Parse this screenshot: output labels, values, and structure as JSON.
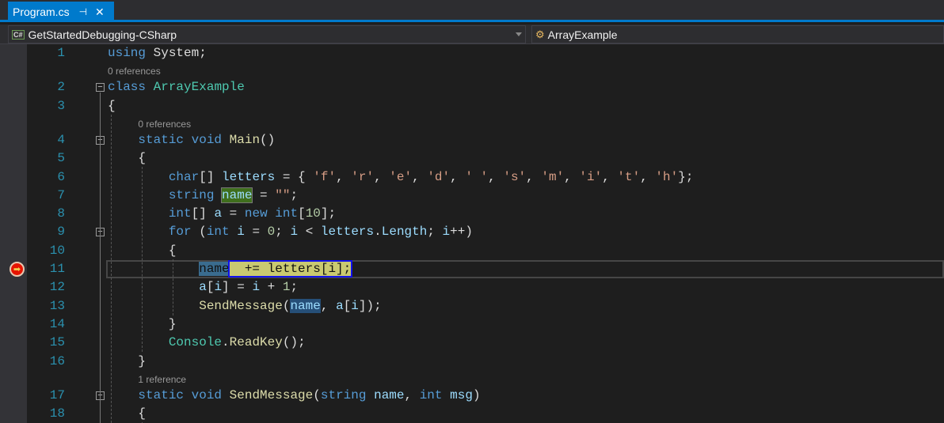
{
  "tab": {
    "title": "Program.cs",
    "pin": "⊣",
    "close": "✕"
  },
  "nav": {
    "project": "GetStartedDebugging-CSharp",
    "project_icon": "C#",
    "class": "ArrayExample"
  },
  "colors": {
    "accent": "#007acc",
    "line_number": "#2b91af",
    "keyword": "#569cd6",
    "type": "#4ec9b0",
    "method": "#dcdcaa",
    "variable": "#9cdcfe",
    "string": "#d69d85"
  },
  "lines": [
    {
      "no": "1",
      "tokens": [
        [
          "using",
          "k"
        ],
        " ",
        [
          "System",
          "c"
        ],
        ";"
      ]
    },
    {
      "ref": "0 references",
      "indent": 0
    },
    {
      "no": "2",
      "fold": true,
      "tokens": [
        [
          "class",
          "k"
        ],
        " ",
        [
          "ArrayExample",
          "t"
        ]
      ]
    },
    {
      "no": "3",
      "tokens": [
        "{"
      ]
    },
    {
      "ref": "0 references",
      "indent": 1
    },
    {
      "no": "4",
      "fold": true,
      "tokens": [
        "    ",
        [
          "static",
          "k"
        ],
        " ",
        [
          "void",
          "k"
        ],
        " ",
        [
          "Main",
          "m"
        ],
        "()"
      ]
    },
    {
      "no": "5",
      "tokens": [
        "    {"
      ]
    },
    {
      "no": "6",
      "tokens": [
        "        ",
        [
          "char",
          "k"
        ],
        "[] ",
        [
          "letters",
          "v"
        ],
        " = { ",
        [
          "'f'",
          "s"
        ],
        ", ",
        [
          "'r'",
          "s"
        ],
        ", ",
        [
          "'e'",
          "s"
        ],
        ", ",
        [
          "'d'",
          "s"
        ],
        ", ",
        [
          "' '",
          "s"
        ],
        ", ",
        [
          "'s'",
          "s"
        ],
        ", ",
        [
          "'m'",
          "s"
        ],
        ", ",
        [
          "'i'",
          "s"
        ],
        ", ",
        [
          "'t'",
          "s"
        ],
        ", ",
        [
          "'h'",
          "s"
        ],
        "};"
      ]
    },
    {
      "no": "7",
      "tokens": [
        "        ",
        [
          "string",
          "k"
        ],
        " ",
        [
          "name",
          "v hl-green"
        ],
        " = ",
        [
          "\"\"",
          "s"
        ],
        ";"
      ]
    },
    {
      "no": "8",
      "tokens": [
        "        ",
        [
          "int",
          "k"
        ],
        "[] ",
        [
          "a",
          "v"
        ],
        " = ",
        [
          "new",
          "k"
        ],
        " ",
        [
          "int",
          "k"
        ],
        "[",
        [
          "10",
          "n"
        ],
        "];"
      ]
    },
    {
      "no": "9",
      "fold": true,
      "tokens": [
        "        ",
        [
          "for",
          "k"
        ],
        " (",
        [
          "int",
          "k"
        ],
        " ",
        [
          "i",
          "v"
        ],
        " = ",
        [
          "0",
          "n"
        ],
        "; ",
        [
          "i",
          "v"
        ],
        " < ",
        [
          "letters",
          "v"
        ],
        ".",
        [
          "Length",
          "v"
        ],
        "; ",
        [
          "i",
          "v"
        ],
        "++)"
      ]
    },
    {
      "no": "10",
      "tokens": [
        "        {"
      ]
    },
    {
      "no": "11",
      "current": true,
      "tokens": [
        "            ",
        [
          "name",
          "hl-cur"
        ],
        [
          "  += letters[i];",
          "hl-yellow"
        ]
      ]
    },
    {
      "no": "12",
      "tokens": [
        "            ",
        [
          "a",
          "v"
        ],
        "[",
        [
          "i",
          "v"
        ],
        "] = ",
        [
          "i",
          "v"
        ],
        " + ",
        [
          "1",
          "n"
        ],
        ";"
      ]
    },
    {
      "no": "13",
      "tokens": [
        "            ",
        [
          "SendMessage",
          "m"
        ],
        "(",
        [
          "name",
          "v hl-blue"
        ],
        ", ",
        [
          "a",
          "v"
        ],
        "[",
        [
          "i",
          "v"
        ],
        "]);"
      ]
    },
    {
      "no": "14",
      "tokens": [
        "        }"
      ]
    },
    {
      "no": "15",
      "tokens": [
        "        ",
        [
          "Console",
          "t"
        ],
        ".",
        [
          "ReadKey",
          "m"
        ],
        "();"
      ]
    },
    {
      "no": "16",
      "tokens": [
        "    }"
      ]
    },
    {
      "ref": "1 reference",
      "indent": 1
    },
    {
      "no": "17",
      "fold": true,
      "tokens": [
        "    ",
        [
          "static",
          "k"
        ],
        " ",
        [
          "void",
          "k"
        ],
        " ",
        [
          "SendMessage",
          "m"
        ],
        "(",
        [
          "string",
          "k"
        ],
        " ",
        [
          "name",
          "v"
        ],
        ", ",
        [
          "int",
          "k"
        ],
        " ",
        [
          "msg",
          "v"
        ],
        ")"
      ]
    },
    {
      "no": "18",
      "tokens": [
        "    {"
      ]
    }
  ]
}
